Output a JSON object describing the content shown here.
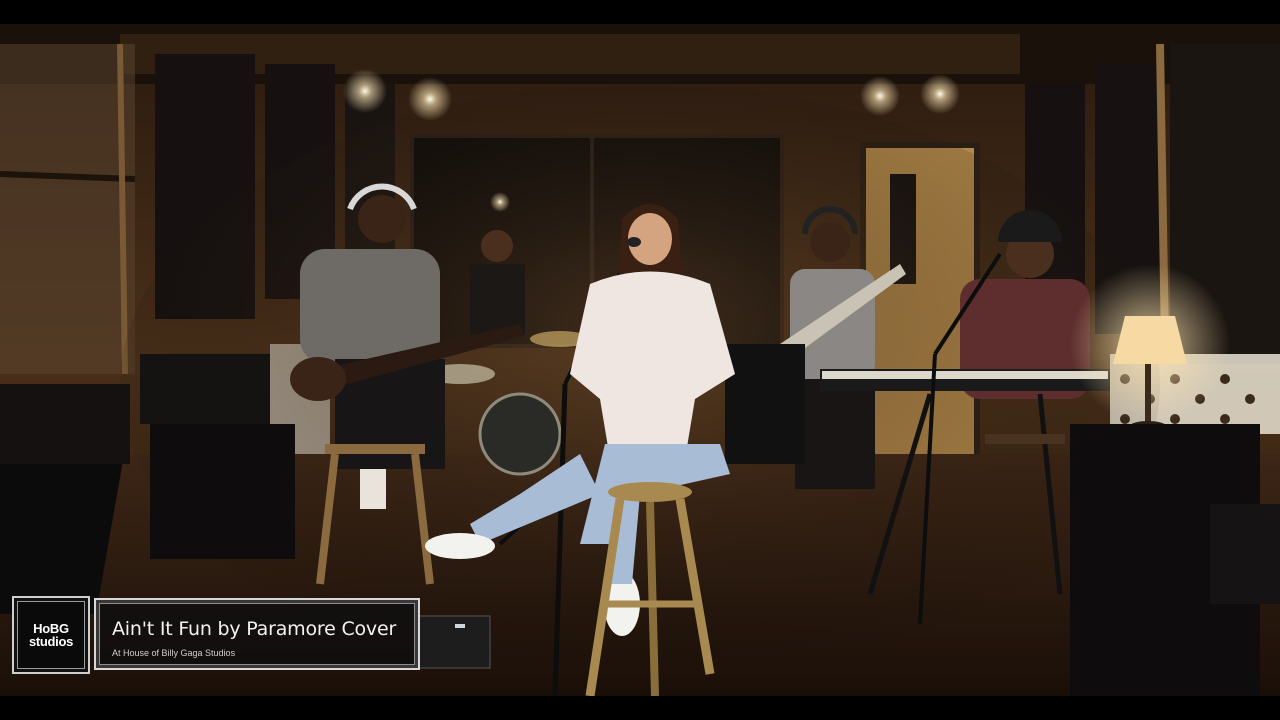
{
  "video": {
    "logo": {
      "line1": "HoBG",
      "line2": "studios"
    },
    "title": "Ain't It Fun by Paramore Cover",
    "subtitle": "At House of Billy Gaga Studios"
  },
  "colors": {
    "wall_wood": "#3a2616",
    "floor_wood": "#3b2414",
    "acoustic_panel": "#171312",
    "overlay_border": "#d8d8d8",
    "lamp_glow": "#f6d9a3"
  }
}
